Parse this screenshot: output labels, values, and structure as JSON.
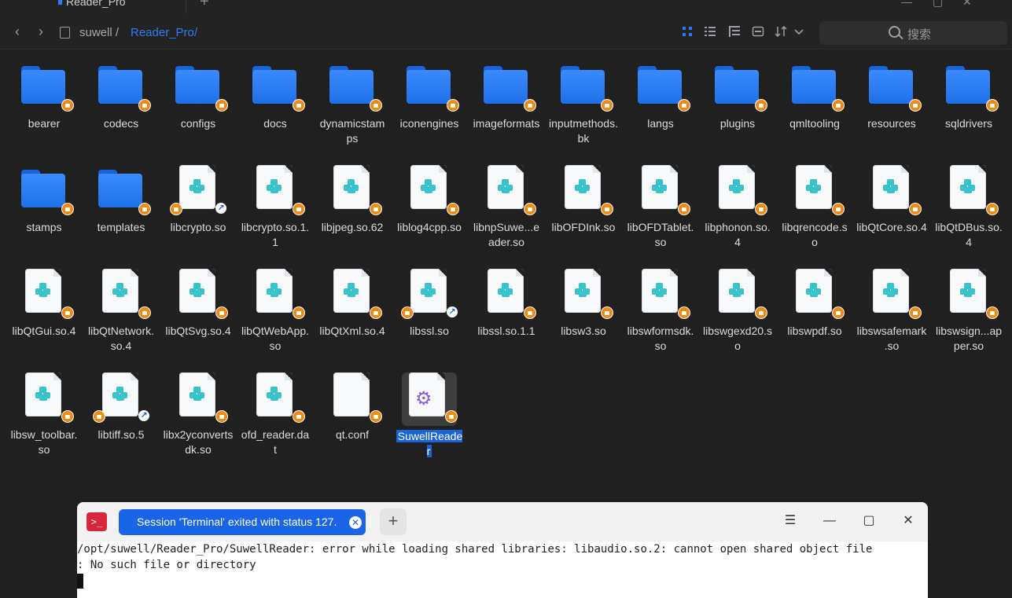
{
  "tab": {
    "title": "Reader_Pro",
    "add": "+"
  },
  "window_controls": [
    "—",
    "▢",
    "✕"
  ],
  "nav": {
    "back": "‹",
    "forward": "›",
    "crumbs": [
      {
        "label": "suwell /",
        "color": "#a9a9a9"
      },
      {
        "label": "Reader_Pro",
        "color": "#2e7cf6"
      },
      {
        "label": "/",
        "color": "#2e7cf6"
      }
    ],
    "search_placeholder": "搜索"
  },
  "files": [
    {
      "name": "bearer",
      "type": "folder"
    },
    {
      "name": "codecs",
      "type": "folder"
    },
    {
      "name": "configs",
      "type": "folder"
    },
    {
      "name": "docs",
      "type": "folder"
    },
    {
      "name": "dynamicstamps",
      "type": "folder"
    },
    {
      "name": "iconengines",
      "type": "folder"
    },
    {
      "name": "imageformats",
      "type": "folder"
    },
    {
      "name": "inputmethods.bk",
      "type": "folder"
    },
    {
      "name": "langs",
      "type": "folder"
    },
    {
      "name": "plugins",
      "type": "folder"
    },
    {
      "name": "qmltooling",
      "type": "folder"
    },
    {
      "name": "resources",
      "type": "folder"
    },
    {
      "name": "sqldrivers",
      "type": "folder"
    },
    {
      "name": "stamps",
      "type": "folder"
    },
    {
      "name": "templates",
      "type": "folder"
    },
    {
      "name": "libcrypto.so",
      "type": "lib",
      "link": true
    },
    {
      "name": "libcrypto.so.1.1",
      "type": "lib"
    },
    {
      "name": "libjpeg.so.62",
      "type": "lib"
    },
    {
      "name": "liblog4cpp.so",
      "type": "lib"
    },
    {
      "name": "libnpSuwe...eader.so",
      "type": "lib"
    },
    {
      "name": "libOFDInk.so",
      "type": "lib"
    },
    {
      "name": "libOFDTablet.so",
      "type": "lib"
    },
    {
      "name": "libphonon.so.4",
      "type": "lib"
    },
    {
      "name": "libqrencode.so",
      "type": "lib"
    },
    {
      "name": "libQtCore.so.4",
      "type": "lib"
    },
    {
      "name": "libQtDBus.so.4",
      "type": "lib"
    },
    {
      "name": "libQtGui.so.4",
      "type": "lib"
    },
    {
      "name": "libQtNetwork.so.4",
      "type": "lib"
    },
    {
      "name": "libQtSvg.so.4",
      "type": "lib"
    },
    {
      "name": "libQtWebApp.so",
      "type": "lib"
    },
    {
      "name": "libQtXml.so.4",
      "type": "lib"
    },
    {
      "name": "libssl.so",
      "type": "lib",
      "link": true
    },
    {
      "name": "libssl.so.1.1",
      "type": "lib"
    },
    {
      "name": "libsw3.so",
      "type": "lib"
    },
    {
      "name": "libswformsdk.so",
      "type": "lib"
    },
    {
      "name": "libswgexd20.so",
      "type": "lib"
    },
    {
      "name": "libswpdf.so",
      "type": "lib"
    },
    {
      "name": "libswsafemark.so",
      "type": "lib"
    },
    {
      "name": "libswsign...apper.so",
      "type": "lib"
    },
    {
      "name": "libsw_toolbar.so",
      "type": "lib"
    },
    {
      "name": "libtiff.so.5",
      "type": "lib",
      "link": true
    },
    {
      "name": "libx2yconvertsdk.so",
      "type": "lib"
    },
    {
      "name": "ofd_reader.dat",
      "type": "lib"
    },
    {
      "name": "qt.conf",
      "type": "text"
    },
    {
      "name": "SuwellReader",
      "type": "exec",
      "selected": true
    }
  ],
  "colors": {
    "folder": "#2f7df2",
    "lock": "#f08a13",
    "selection": "#1a64d8",
    "lib_mark": "#37c3c9"
  },
  "terminal": {
    "logo": ">_",
    "tab_label": "Session 'Terminal' exited with status 127.",
    "tab_close": "✕",
    "add": "+",
    "controls": [
      "☰",
      "—",
      "▢",
      "✕"
    ],
    "lines": [
      "/opt/suwell/Reader_Pro/SuwellReader: error while loading shared libraries: libaudio.so.2: cannot open shared object file",
      ": No such file or directory"
    ]
  }
}
